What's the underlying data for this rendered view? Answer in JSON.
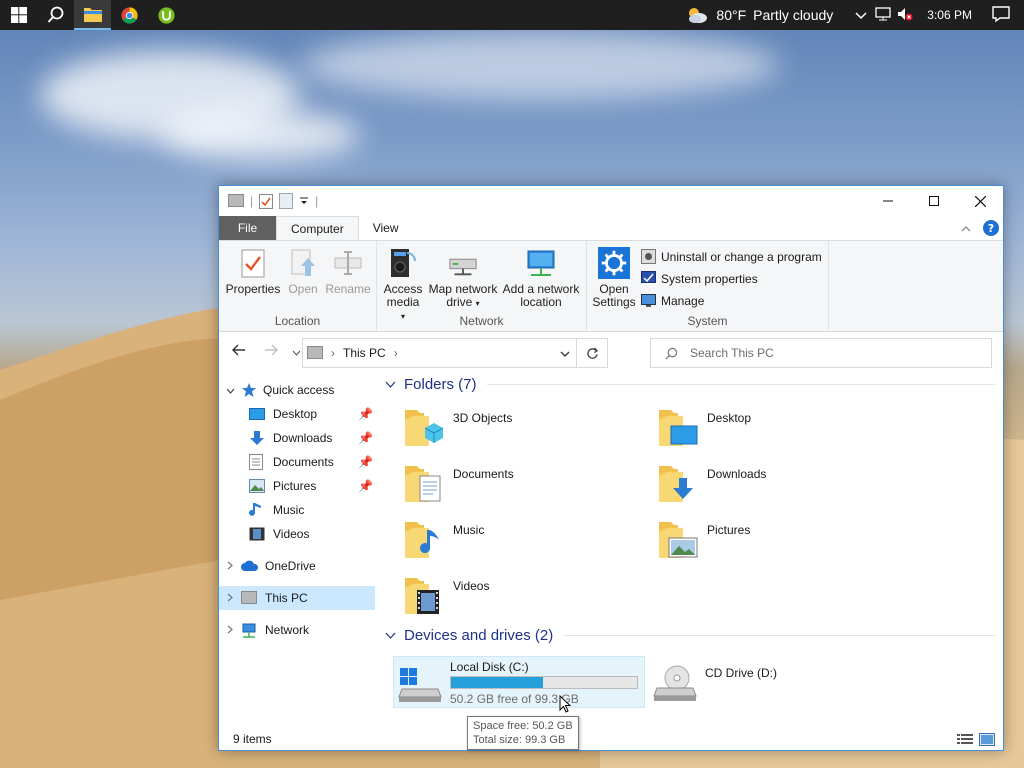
{
  "taskbar": {
    "weather_temp": "80°F",
    "weather_text": "Partly cloudy",
    "clock": "3:06 PM"
  },
  "window": {
    "ribbon_tabs": [
      "File",
      "Computer",
      "View"
    ],
    "groups": {
      "location": {
        "label": "Location",
        "properties": "Properties",
        "open": "Open",
        "rename": "Rename"
      },
      "network": {
        "label": "Network",
        "access_media_1": "Access",
        "access_media_2": "media",
        "map_drive_1": "Map network",
        "map_drive_2": "drive",
        "add_location_1": "Add a network",
        "add_location_2": "location"
      },
      "system": {
        "label": "System",
        "open_settings_1": "Open",
        "open_settings_2": "Settings",
        "uninstall": "Uninstall or change a program",
        "system_properties": "System properties",
        "manage": "Manage"
      }
    },
    "address": {
      "crumb": "This PC"
    },
    "search": {
      "placeholder": "Search This PC"
    },
    "nav": {
      "quick_access": "Quick access",
      "desktop": "Desktop",
      "downloads": "Downloads",
      "documents": "Documents",
      "pictures": "Pictures",
      "music": "Music",
      "videos": "Videos",
      "onedrive": "OneDrive",
      "this_pc": "This PC",
      "network": "Network"
    },
    "folders_header": "Folders (7)",
    "folders": [
      "3D Objects",
      "Desktop",
      "Documents",
      "Downloads",
      "Music",
      "Pictures",
      "Videos"
    ],
    "devices_header": "Devices and drives (2)",
    "drives": {
      "c_name": "Local Disk (C:)",
      "c_free": "50.2 GB free of 99.3 GB",
      "c_used_fraction": 0.494,
      "d_name": "CD Drive (D:)"
    },
    "status": "9 items",
    "tooltip": {
      "line1": "Space free: 50.2 GB",
      "line2": "Total size: 99.3 GB"
    }
  }
}
